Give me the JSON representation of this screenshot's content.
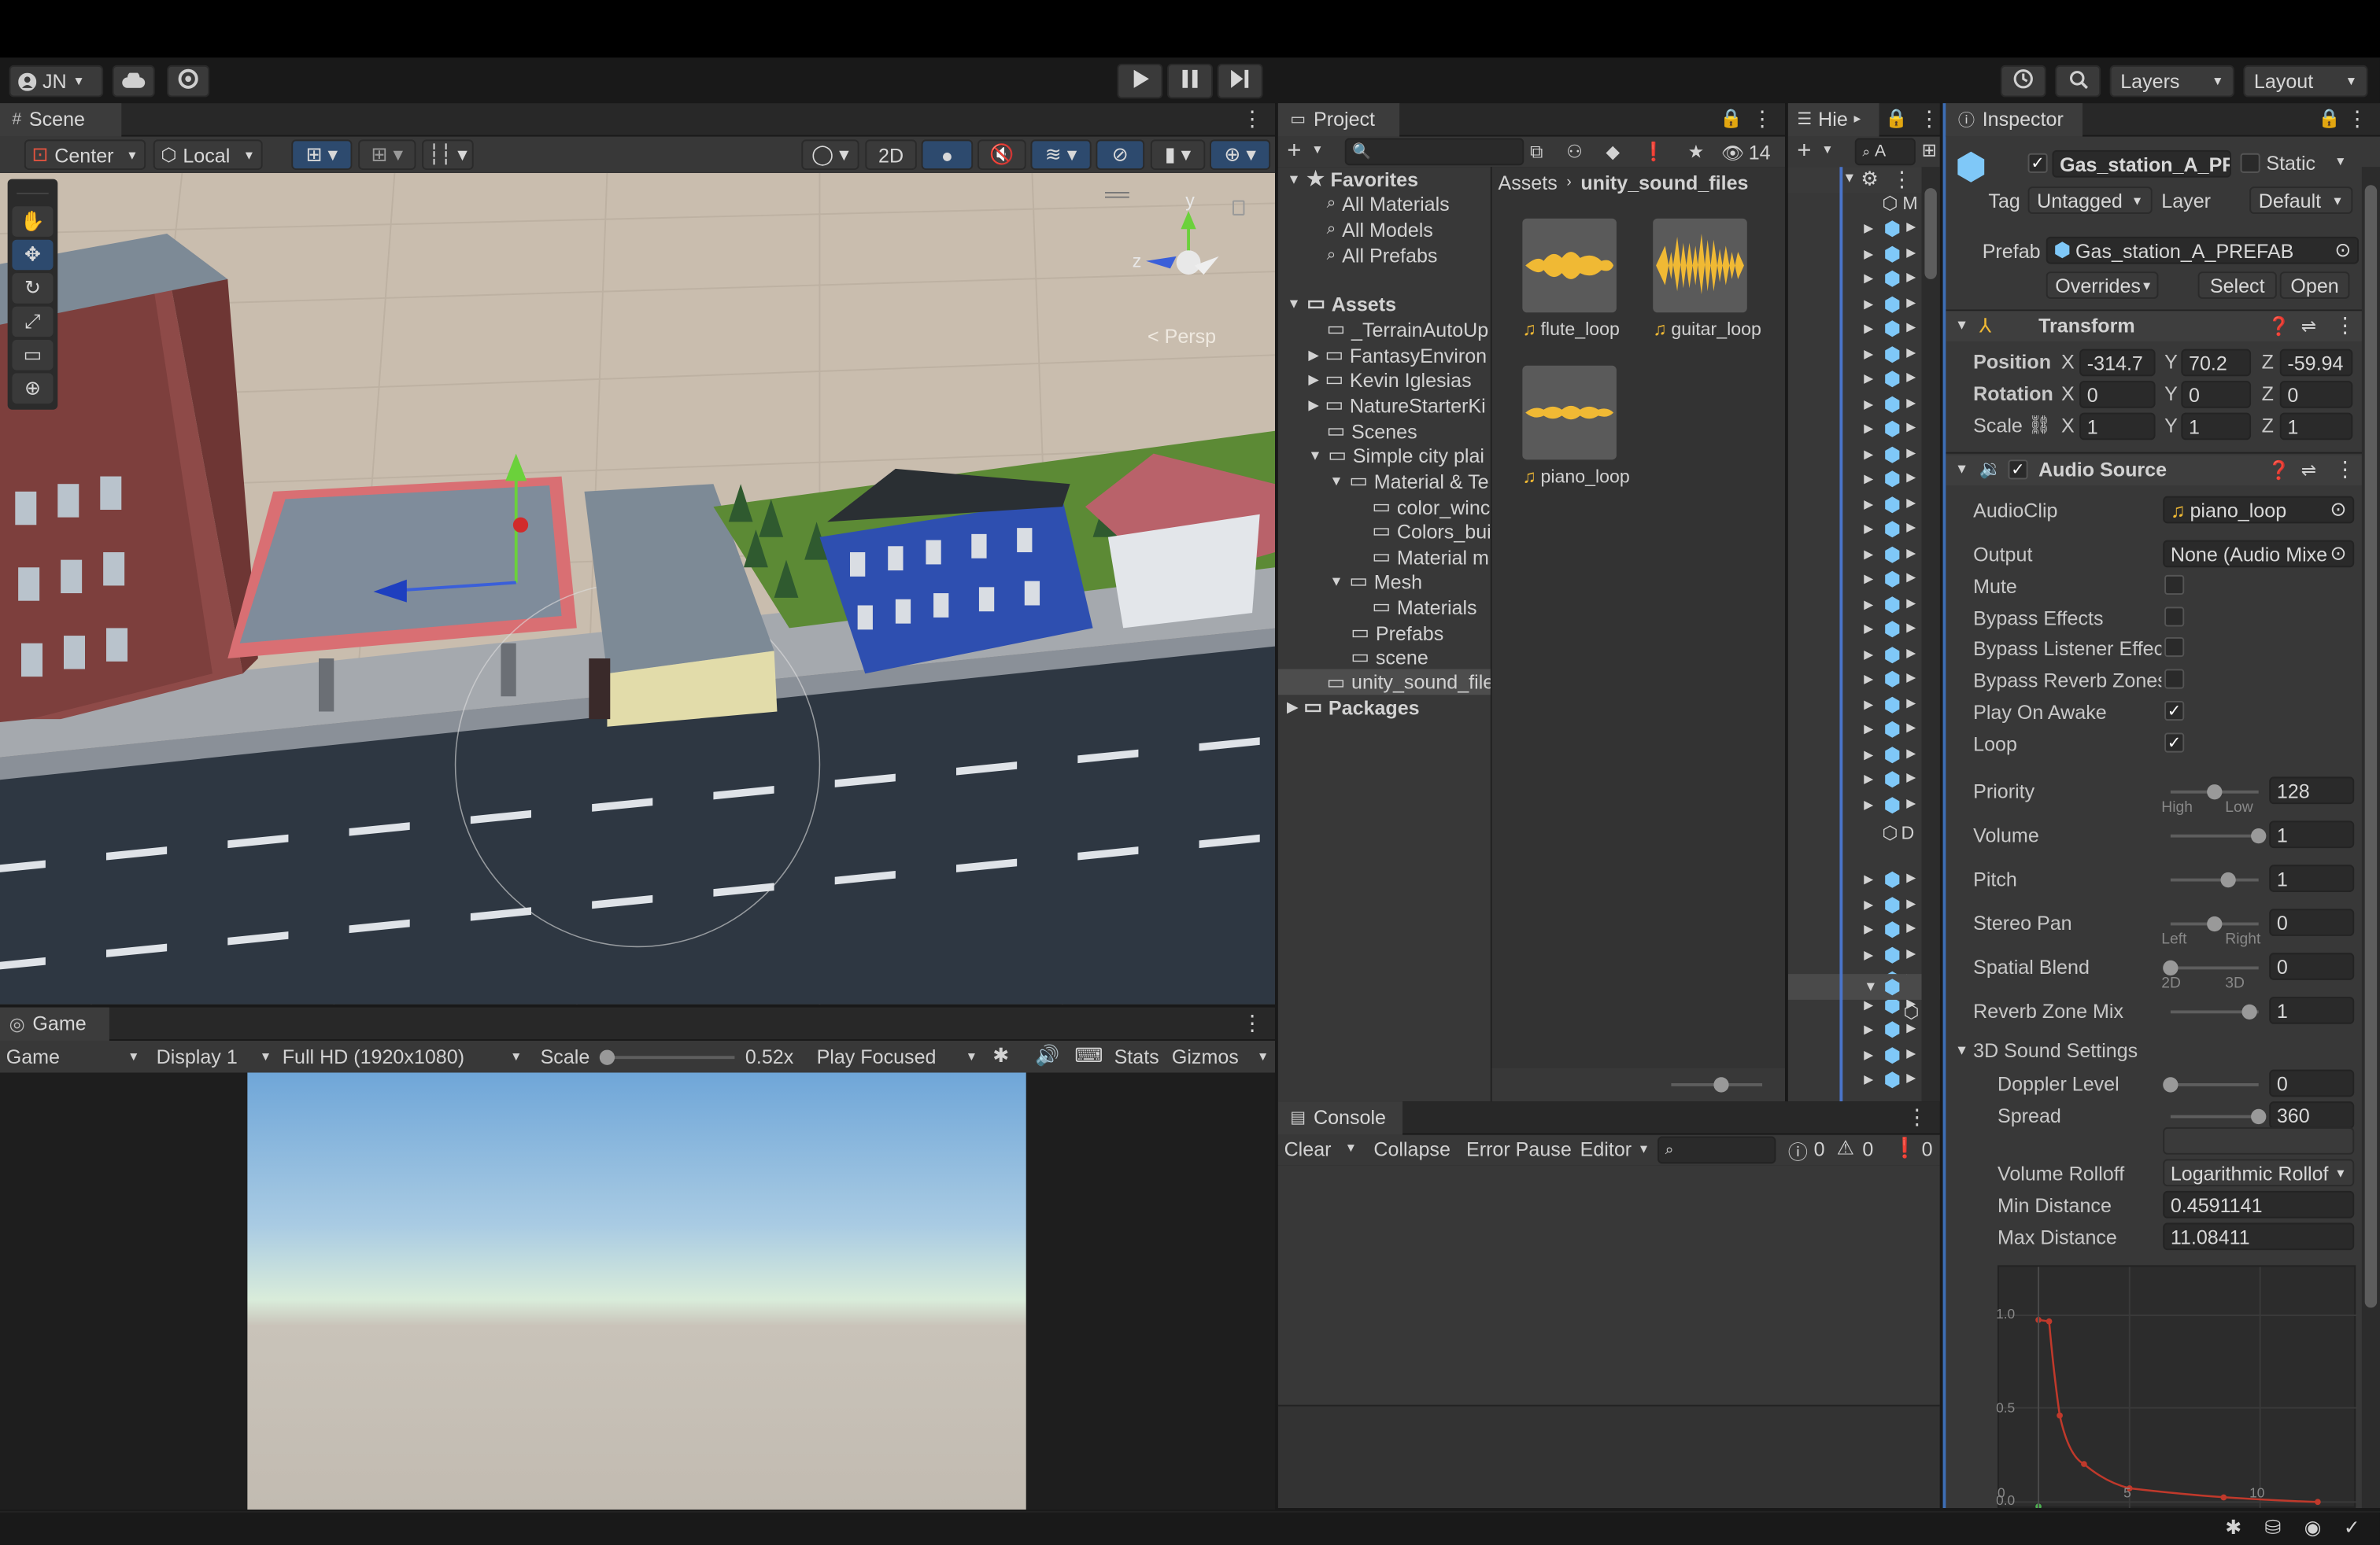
{
  "toolbar": {
    "account": "JN",
    "layers": "Layers",
    "layout": "Layout"
  },
  "scene": {
    "tab": "Scene",
    "center": "Center",
    "local": "Local",
    "mode2d": "2D",
    "persp": "< Persp",
    "gizmo_y": "y",
    "gizmo_z": "z"
  },
  "game": {
    "tab": "Game",
    "view": "Game",
    "display": "Display 1",
    "resolution": "Full HD (1920x1080)",
    "scale_label": "Scale",
    "scale_value": "0.52x",
    "play_mode": "Play Focused",
    "stats": "Stats",
    "gizmos": "Gizmos"
  },
  "project": {
    "tab": "Project",
    "count": "14",
    "breadcrumb": [
      "Assets",
      "unity_sound_files"
    ],
    "favorites": {
      "label": "Favorites",
      "items": [
        "All Materials",
        "All Models",
        "All Prefabs"
      ]
    },
    "assets_label": "Assets",
    "folders": [
      "_TerrainAutoUp",
      "FantasyEnviron",
      "Kevin Iglesias",
      "NatureStarterKi",
      "Scenes",
      "Simple city plai",
      "Material & Te",
      "color_winc",
      "Colors_bui",
      "Material m",
      "Mesh",
      "Materials",
      "Prefabs",
      "scene",
      "unity_sound_file"
    ],
    "packages_label": "Packages",
    "files": [
      "flute_loop",
      "guitar_loop",
      "piano_loop"
    ]
  },
  "hierarchy": {
    "tab": "Hie",
    "search": "A",
    "first_item": "M",
    "group_item": "D"
  },
  "console": {
    "tab": "Console",
    "clear": "Clear",
    "collapse": "Collapse",
    "error_pause": "Error Pause",
    "editor": "Editor",
    "info_count": "0",
    "warn_count": "0",
    "err_count": "0"
  },
  "inspector": {
    "tab": "Inspector",
    "object_name": "Gas_station_A_PRE",
    "static": "Static",
    "tag_label": "Tag",
    "tag": "Untagged",
    "layer_label": "Layer",
    "layer": "Default",
    "prefab_label": "Prefab",
    "prefab": "Gas_station_A_PREFAB",
    "overrides": "Overrides",
    "select": "Select",
    "open": "Open",
    "transform": {
      "title": "Transform",
      "position": "Position",
      "rotation": "Rotation",
      "scale": "Scale",
      "px": "-314.7",
      "py": "70.2",
      "pz": "-59.94",
      "rx": "0",
      "ry": "0",
      "rz": "0",
      "sx": "1",
      "sy": "1",
      "sz": "1",
      "x": "X",
      "y": "Y",
      "z": "Z"
    },
    "audio": {
      "title": "Audio Source",
      "clip_label": "AudioClip",
      "clip": "piano_loop",
      "output_label": "Output",
      "output": "None (Audio Mixe",
      "mute": "Mute",
      "bypass_effects": "Bypass Effects",
      "bypass_listener": "Bypass Listener Effec",
      "bypass_reverb": "Bypass Reverb Zones",
      "play_on_awake": "Play On Awake",
      "loop": "Loop",
      "priority": "Priority",
      "priority_value": "128",
      "priority_min": "High",
      "priority_max": "Low",
      "priority_level": 0.5,
      "volume": "Volume",
      "volume_value": "1",
      "volume_level": 1,
      "pitch": "Pitch",
      "pitch_value": "1",
      "pitch_level": 0.66,
      "stereo_pan": "Stereo Pan",
      "stereo_pan_value": "0",
      "pan_min": "Left",
      "pan_max": "Right",
      "pan_level": 0.5,
      "spatial_blend": "Spatial Blend",
      "spatial_blend_value": "0",
      "blend_min": "2D",
      "blend_max": "3D",
      "blend_level": 0,
      "reverb_mix": "Reverb Zone Mix",
      "reverb_mix_value": "1",
      "reverb_level": 0.9,
      "settings3d": "3D Sound Settings",
      "doppler": "Doppler Level",
      "doppler_value": "0",
      "doppler_level": 0,
      "spread": "Spread",
      "spread_value": "360",
      "spread_level": 1,
      "rolloff": "Volume Rolloff",
      "rolloff_value": "Logarithmic Rollof",
      "min_dist": "Min Distance",
      "min_dist_value": "0.4591141",
      "max_dist": "Max Distance",
      "max_dist_value": "11.08411"
    },
    "graph": {
      "y_labels": [
        "1.0",
        "0.5",
        "0.0"
      ],
      "x_labels": [
        "0",
        "5",
        "10"
      ]
    }
  }
}
